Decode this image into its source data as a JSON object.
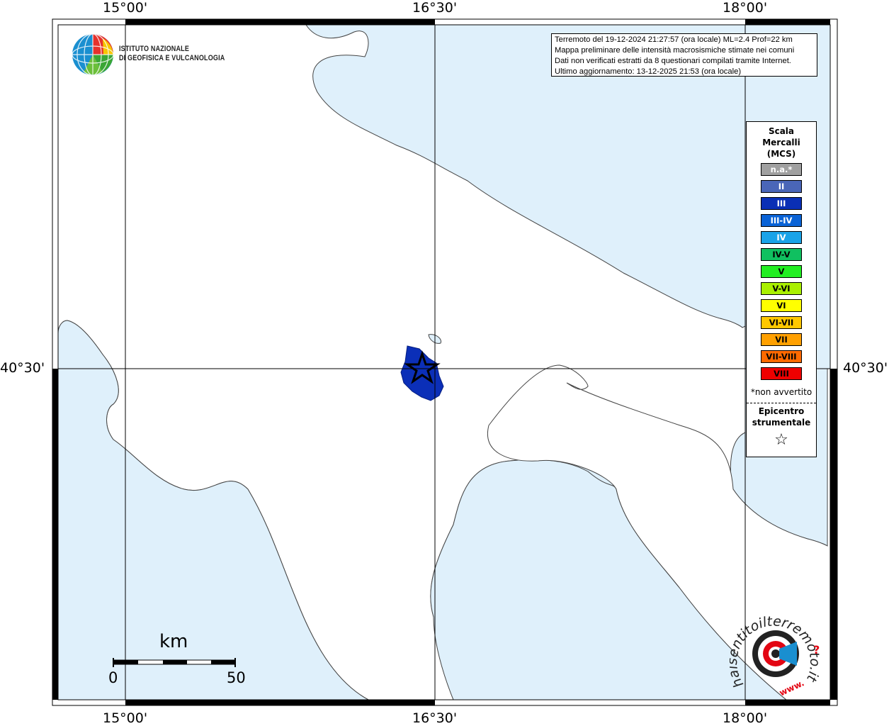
{
  "map": {
    "lon_labels": [
      "15°00'",
      "16°30'",
      "18°00'"
    ],
    "lat_labels": [
      "40°30'"
    ],
    "colors": {
      "sea": "#dff0fb",
      "land": "#ffffff",
      "affected_area": "#0b2fb8",
      "frame": "#000000"
    }
  },
  "info": {
    "line1": "Terremoto del 19-12-2024 21:27:57 (ora locale) ML=2.4 Prof=22 km",
    "line2": "Mappa preliminare delle intensità macrosismiche stimate nei comuni",
    "line3": "Dati non verificati estratti da 8 questionari compilati tramite Internet.",
    "line4": "Ultimo aggiornamento: 13-12-2025 21:53 (ora locale)"
  },
  "ingv_logo": {
    "line1": "ISTITUTO NAZIONALE",
    "line2": "DI GEOFISICA E VULCANOLOGIA"
  },
  "legend": {
    "title_lines": [
      "Scala",
      "Mercalli",
      "(MCS)"
    ],
    "items": [
      {
        "label": "n.a.*",
        "color": "#a0a0a0",
        "text_color": "#ffffff"
      },
      {
        "label": "II",
        "color": "#4a66b8",
        "text_color": "#ffffff"
      },
      {
        "label": "III",
        "color": "#0a2fb5",
        "text_color": "#ffffff"
      },
      {
        "label": "III-IV",
        "color": "#0a63d6",
        "text_color": "#ffffff"
      },
      {
        "label": "IV",
        "color": "#1aa3e8",
        "text_color": "#ffffff"
      },
      {
        "label": "IV-V",
        "color": "#10c060",
        "text_color": "#000000"
      },
      {
        "label": "V",
        "color": "#22ee22",
        "text_color": "#000000"
      },
      {
        "label": "V-VI",
        "color": "#aaf000",
        "text_color": "#000000"
      },
      {
        "label": "VI",
        "color": "#ffff00",
        "text_color": "#000000"
      },
      {
        "label": "VI-VII",
        "color": "#ffc800",
        "text_color": "#000000"
      },
      {
        "label": "VII",
        "color": "#ffa000",
        "text_color": "#000000"
      },
      {
        "label": "VII-VIII",
        "color": "#ff6a00",
        "text_color": "#000000"
      },
      {
        "label": "VIII",
        "color": "#ee0000",
        "text_color": "#000000"
      }
    ],
    "note": "*non avvertito",
    "epicenter_lines": [
      "Epicentro",
      "strumentale"
    ],
    "star_symbol": "☆"
  },
  "scale_bar": {
    "unit": "km",
    "label_start": "0",
    "label_end": "50"
  },
  "hst_logo": {
    "text_main": "haisentitoilterremoto.it",
    "prefix": "www.",
    "question": "?"
  }
}
